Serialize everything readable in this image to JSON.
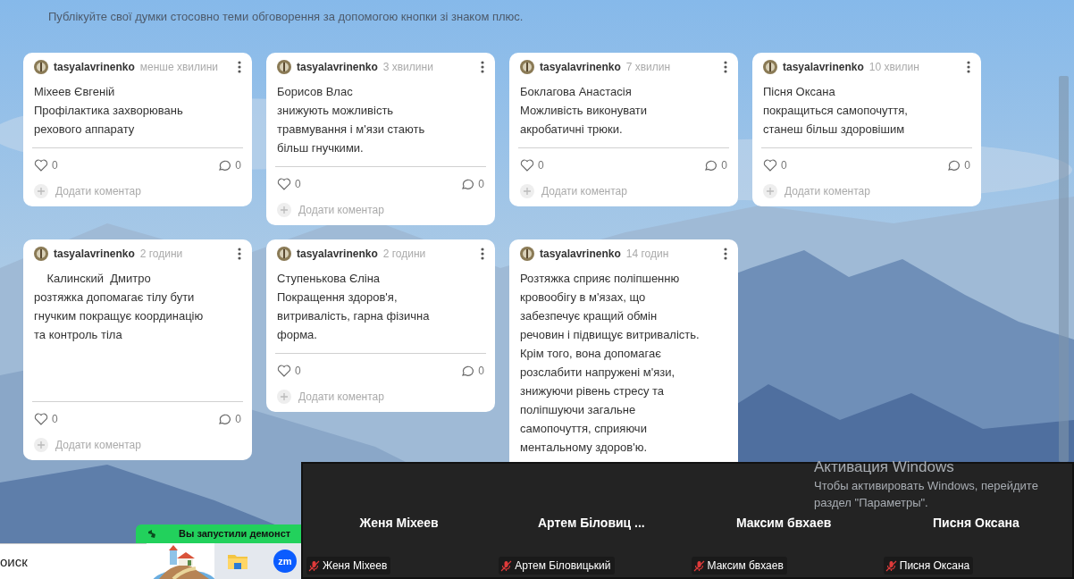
{
  "header": {
    "subtitle": "Публікуйте свої думки стосовно теми обговорення за допомогою кнопки зі знаком плюс."
  },
  "posts": [
    {
      "author": "tasyalavrinenko",
      "time": "менше хвилини",
      "text": "Міхеев Євгеній\nПрофілактика захворювань\nрехового аппарату",
      "likes": "0",
      "comments": "0",
      "add_comment": "Додати коментар"
    },
    {
      "author": "tasyalavrinenko",
      "time": "3 хвилини",
      "text": "Борисов Влас\nзнижують можливість\nтравмування і м'язи стають\nбільш гнучкими.",
      "likes": "0",
      "comments": "0",
      "add_comment": "Додати коментар"
    },
    {
      "author": "tasyalavrinenko",
      "time": "7 хвилин",
      "text": "Боклагова Анастасія\nМожливість виконувати\nакробатичні трюки.",
      "likes": "0",
      "comments": "0",
      "add_comment": "Додати коментар"
    },
    {
      "author": "tasyalavrinenko",
      "time": "10 хвилин",
      "text": "Пісня Оксана\nпокращиться самопочуття,\nстанеш більш здоровішим",
      "likes": "0",
      "comments": "0",
      "add_comment": "Додати коментар"
    },
    {
      "author": "tasyalavrinenko",
      "time": "2 години",
      "text": "    Калинский  Дмитро\nрозтяжка допомагає тілу бути\nгнучким покращує координацію\nта контроль тіла",
      "likes": "0",
      "comments": "0",
      "add_comment": "Додати коментар",
      "tall": true
    },
    {
      "author": "tasyalavrinenko",
      "time": "2 години",
      "text": "Ступенькова Єліна\nПокращення здоров'я,\nвитривалість, гарна фізична\nформа.",
      "likes": "0",
      "comments": "0",
      "add_comment": "Додати коментар"
    },
    {
      "author": "tasyalavrinenko",
      "time": "14 годин",
      "text": "Розтяжка сприяє поліпшенню\nкровообігу в м'язах, що\nзабезпечує кращий обмін\nречовин і підвищує витривалість.\nКрім того, вона допомагає\nрозслабити напружені м'язи,\nзнижуючи рівень стресу та\nполіпшуючи загальне\nсамопочуття, сприяючи\nментальному здоров'ю."
    }
  ],
  "meeting_panel": {
    "participants": [
      {
        "name": "Женя Міхеев",
        "label": "Женя Міхеев",
        "muted": true
      },
      {
        "name": "Артем Біловиц ...",
        "label": "Артем Біловицький",
        "muted": true
      },
      {
        "name": "Максим бвхаев",
        "label": "Максим бвхаев",
        "muted": true
      },
      {
        "name": "Писня Оксана",
        "label": "Писня Оксана",
        "muted": true
      }
    ]
  },
  "activation": {
    "title": "Активация Windows",
    "lines": [
      "Чтобы активировать Windows, перейдите",
      "раздел \"Параметры\"."
    ]
  },
  "share_banner": {
    "text": "Вы запустили демонст"
  },
  "taskbar": {
    "search_placeholder": "оиск",
    "zoom_label": "zm"
  }
}
